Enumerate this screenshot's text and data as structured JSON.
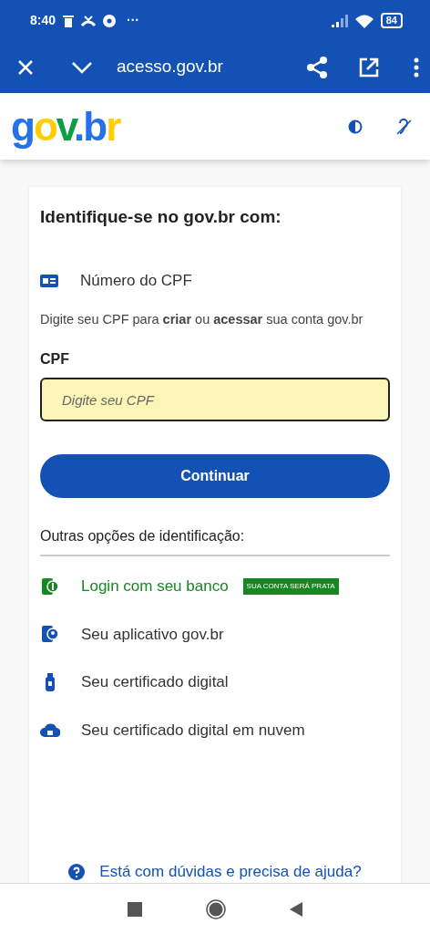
{
  "status_bar": {
    "time": "8:40",
    "more": "···",
    "battery": "84"
  },
  "browser_bar": {
    "url": "acesso.gov.br"
  },
  "header": {
    "logo": "gov.br"
  },
  "card": {
    "title": "Identifique-se no gov.br com:",
    "cpf_option": {
      "label": "Número do CPF"
    },
    "description": "Digite seu CPF para **criar** ou **acessar** sua conta gov.br",
    "cpf_field": {
      "label": "CPF",
      "placeholder": "Digite seu CPF"
    },
    "continue_button": "Continuar",
    "other_heading": "Outras opções de identificação:",
    "options": [
      {
        "kind": "bank",
        "label": "Login com seu banco",
        "color": "#168821",
        "badge": "SUA CONTA SERÁ PRATA"
      },
      {
        "kind": "app",
        "label": "Seu aplicativo gov.br",
        "color": "#333333"
      },
      {
        "kind": "usb",
        "label": "Seu certificado digital",
        "color": "#333333"
      },
      {
        "kind": "cloud",
        "label": "Seu certificado digital em nuvem",
        "color": "#333333"
      }
    ],
    "help_link": "Está com dúvidas e precisa de ajuda?"
  }
}
